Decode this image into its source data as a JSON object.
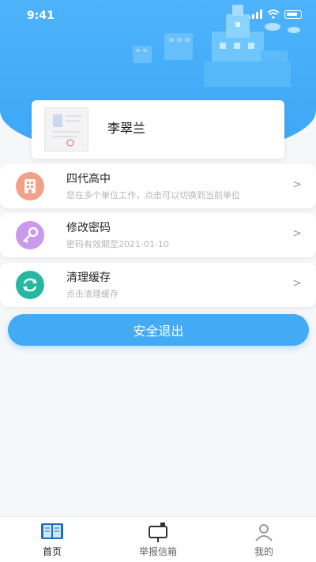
{
  "status_bar": {
    "time": "9:41"
  },
  "user": {
    "name": "李翠兰"
  },
  "menu": [
    {
      "title": "四代高中",
      "subtitle": "您在多个单位工作，点击可以切换到当前单位",
      "icon": "building-icon",
      "color": "#f2a088"
    },
    {
      "title": "修改密码",
      "subtitle": "密码有效期至2021-01-10",
      "icon": "key-icon",
      "color": "#c999ec"
    },
    {
      "title": "清理缓存",
      "subtitle": "点击清理缓存",
      "icon": "refresh-icon",
      "color": "#26b7a2"
    }
  ],
  "chevron": ">",
  "logout_label": "安全退出",
  "tabs": [
    {
      "label": "首页",
      "icon": "book-icon"
    },
    {
      "label": "举报信箱",
      "icon": "mailbox-icon"
    },
    {
      "label": "我的",
      "icon": "user-icon"
    }
  ],
  "colors": {
    "accent": "#43aaf5",
    "header": "#4db3fb"
  }
}
